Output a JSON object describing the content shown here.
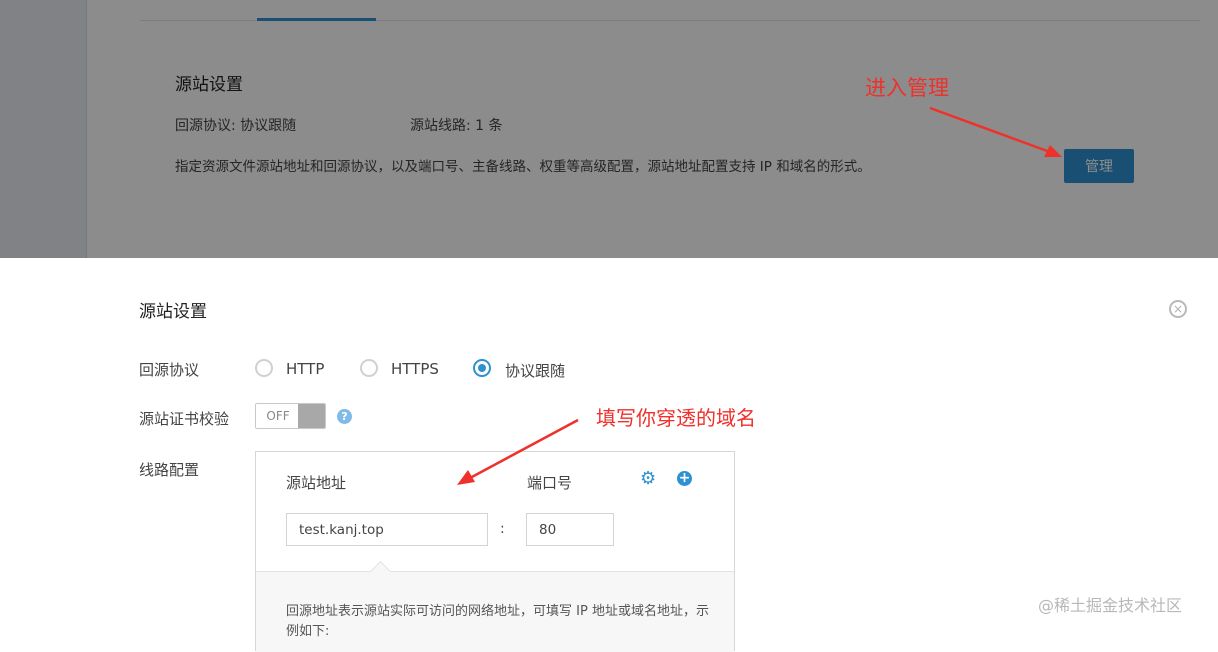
{
  "top": {
    "title": "源站设置",
    "protocol_text": "回源协议:  协议跟随",
    "lines_text": "源站线路: 1 条",
    "description": "指定资源文件源站地址和回源协议，以及端口号、主备线路、权重等高级配置，源站地址配置支持 IP 和域名的形式。",
    "manage_label": "管理"
  },
  "annotations": {
    "enter_manage": "进入管理",
    "fill_domain": "填写你穿透的域名",
    "arrow_color": "#f0302a"
  },
  "dialog": {
    "title": "源站设置",
    "close_icon": "close-icon",
    "protocol_label": "回源协议",
    "protocol_options": [
      "HTTP",
      "HTTPS",
      "协议跟随"
    ],
    "protocol_selected": "协议跟随",
    "ssl_label": "源站证书校验",
    "ssl_toggle": "OFF",
    "route_label": "线路配置",
    "panel": {
      "origin_header": "源站地址",
      "port_header": "端口号",
      "origin_value": "test.kanj.top",
      "separator": ":",
      "port_value": "80",
      "note": "回源地址表示源站实际可访问的网络地址，可填写 IP 地址或域名地址，示例如下:"
    }
  },
  "watermark": "@稀土掘金技术社区",
  "colors": {
    "accent": "#2e91d2"
  }
}
